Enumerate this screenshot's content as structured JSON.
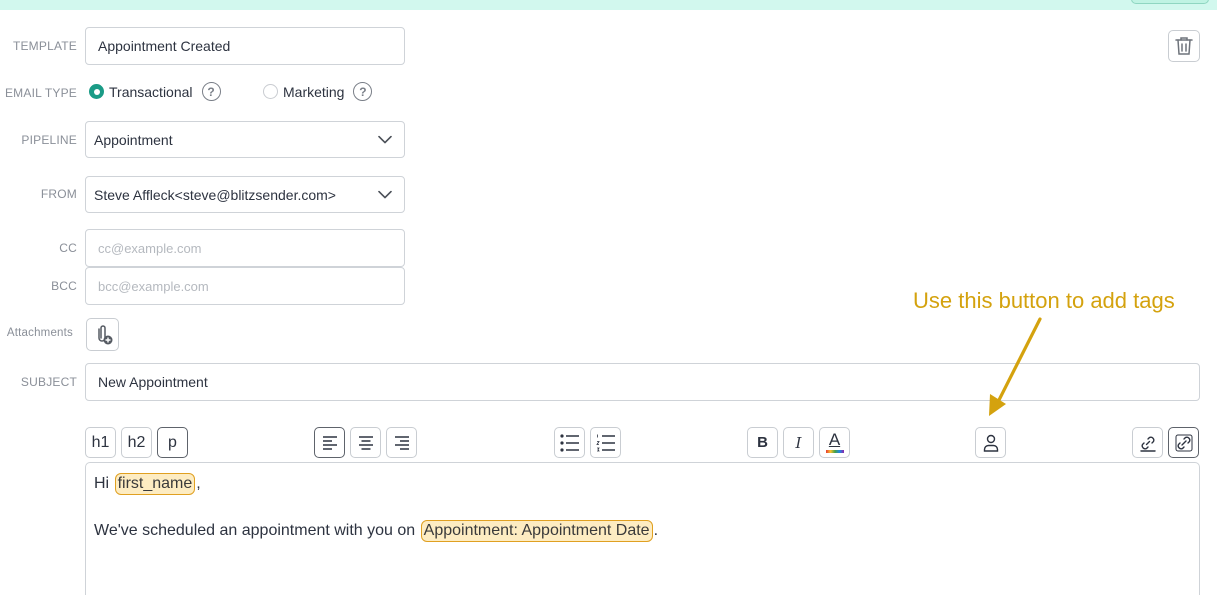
{
  "form": {
    "template_label": "TEMPLATE",
    "template_value": "Appointment Created",
    "email_type_label": "EMAIL TYPE",
    "email_type_options": [
      "Transactional",
      "Marketing"
    ],
    "email_type_selected": "Transactional",
    "help_glyph": "?",
    "pipeline_label": "PIPELINE",
    "pipeline_value": "Appointment",
    "from_label": "FROM",
    "from_value": "Steve Affleck<steve@blitzsender.com>",
    "cc_label": "CC",
    "cc_placeholder": "cc@example.com",
    "bcc_label": "BCC",
    "bcc_placeholder": "bcc@example.com",
    "attachments_label": "Attachments",
    "subject_label": "SUBJECT",
    "subject_value": "New Appointment"
  },
  "toolbar": {
    "h1": "h1",
    "h2": "h2",
    "p": "p",
    "bold": "B",
    "italic": "I",
    "text_color": "A",
    "icons": [
      "align-left-icon",
      "align-center-icon",
      "align-right-icon",
      "bullet-list-icon",
      "numbered-list-icon",
      "text-color-icon",
      "person-tag-icon",
      "link-icon",
      "unlink-icon"
    ]
  },
  "editor": {
    "line1_prefix": "Hi ",
    "line1_tag": "first_name",
    "line1_suffix": ",",
    "line2_prefix": "We've scheduled an appointment with you on ",
    "line2_tag": "Appointment: Appointment Date",
    "line2_suffix": "."
  },
  "annotation": {
    "text": "Use this button to add tags",
    "color": "#d4a20e"
  },
  "colors": {
    "accent": "#1a9b86",
    "tag_fill": "#fdecc2",
    "tag_border": "#e0a021",
    "top_banner": "#d2f8ee"
  }
}
